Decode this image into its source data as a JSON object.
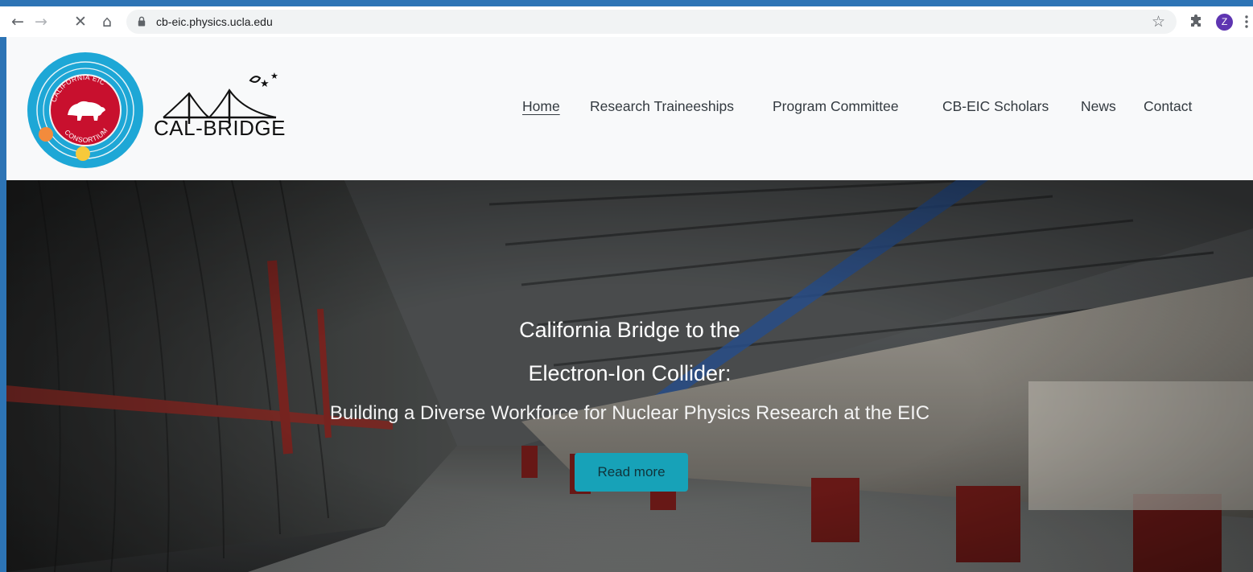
{
  "browser": {
    "url": "cb-eic.physics.ucla.edu",
    "profile_initial": "Z",
    "nav_icons": {
      "back": "←",
      "forward": "→",
      "stop": "✕",
      "home": "⌂"
    },
    "star_icon": "☆"
  },
  "header": {
    "seal_logo_text": "CALIFORNIA EIC CONSORTIUM",
    "calbridge_text": "CAL-BRIDGE",
    "nav": [
      {
        "label": "Home",
        "active": true
      },
      {
        "label": "Research Traineeships"
      },
      {
        "label": "Program Committee"
      },
      {
        "label": "CB-EIC Scholars"
      },
      {
        "label": "News"
      },
      {
        "label": "Contact"
      }
    ]
  },
  "hero": {
    "title_line1": "California Bridge to the",
    "title_line2": "Electron-Ion Collider:",
    "subtitle": "Building a Diverse Workforce for Nuclear Physics Research at the EIC",
    "button_label": "Read more"
  },
  "colors": {
    "button_bg": "#17a2b8",
    "avatar_bg": "#5e35b1",
    "seal_ring": "#1ea7d6",
    "seal_center": "#c8102e"
  }
}
